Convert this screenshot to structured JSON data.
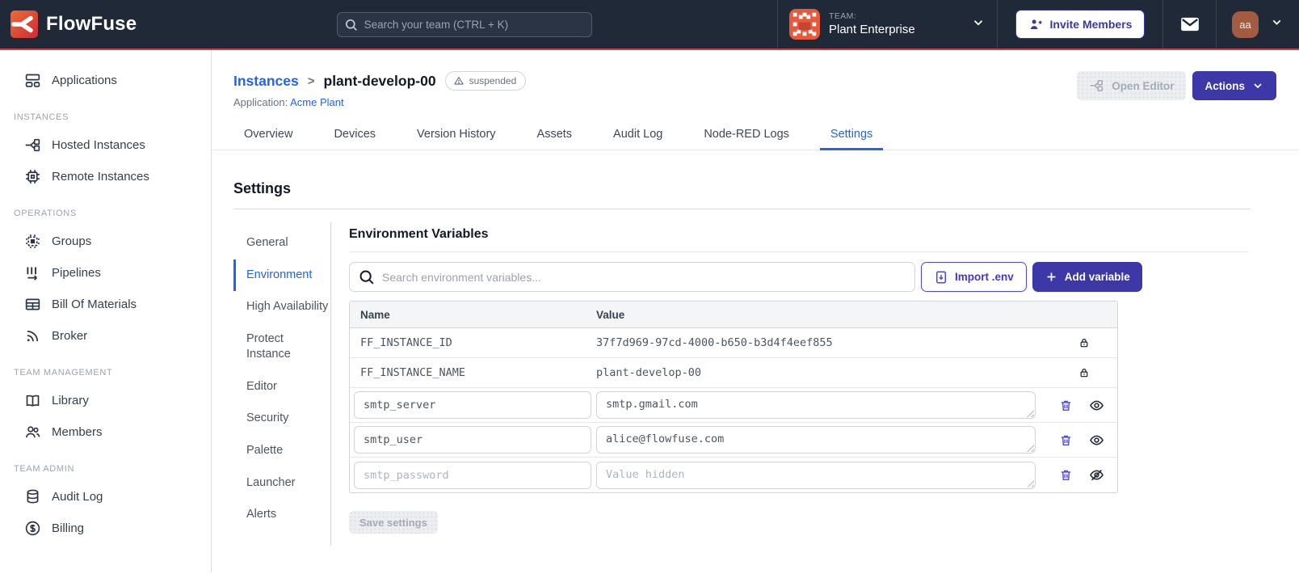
{
  "colors": {
    "navbar_bg": "#1F2937",
    "accent_red": "#D23B3B",
    "link_blue": "#2563EB",
    "primary_indigo": "#3D38A8",
    "icon_indigo": "#4F46E5",
    "team_icon_orange": "#E8593C",
    "avatar_brown": "#A35C42"
  },
  "navbar": {
    "brand": "FlowFuse",
    "search_placeholder": "Search your team (CTRL + K)",
    "team_label": "TEAM:",
    "team_name": "Plant Enterprise",
    "invite_label": "Invite Members",
    "avatar_initials": "aa"
  },
  "sidebar": {
    "sections": [
      {
        "header": "",
        "items": [
          {
            "label": "Applications"
          }
        ]
      },
      {
        "header": "INSTANCES",
        "items": [
          {
            "label": "Hosted Instances"
          },
          {
            "label": "Remote Instances"
          }
        ]
      },
      {
        "header": "OPERATIONS",
        "items": [
          {
            "label": "Groups"
          },
          {
            "label": "Pipelines"
          },
          {
            "label": "Bill Of Materials"
          },
          {
            "label": "Broker"
          }
        ]
      },
      {
        "header": "TEAM MANAGEMENT",
        "items": [
          {
            "label": "Library"
          },
          {
            "label": "Members"
          }
        ]
      },
      {
        "header": "TEAM ADMIN",
        "items": [
          {
            "label": "Audit Log"
          },
          {
            "label": "Billing"
          }
        ]
      }
    ]
  },
  "page_header": {
    "breadcrumb_parent": "Instances",
    "breadcrumb_separator": ">",
    "breadcrumb_current": "plant-develop-00",
    "status_badge": "suspended",
    "application_label": "Application:",
    "application_name": "Acme Plant",
    "open_editor_label": "Open Editor",
    "actions_label": "Actions"
  },
  "tabs": {
    "items": [
      "Overview",
      "Devices",
      "Version History",
      "Assets",
      "Audit Log",
      "Node-RED Logs",
      "Settings"
    ],
    "active": "Settings"
  },
  "settings": {
    "title": "Settings",
    "nav": [
      "General",
      "Environment",
      "High Availability",
      "Protect Instance",
      "Editor",
      "Security",
      "Palette",
      "Launcher",
      "Alerts"
    ],
    "active": "Environment"
  },
  "environment": {
    "title": "Environment Variables",
    "search_placeholder": "Search environment variables...",
    "import_label": "Import .env",
    "add_label": "Add variable",
    "columns": {
      "name": "Name",
      "value": "Value"
    },
    "locked_rows": [
      {
        "name": "FF_INSTANCE_ID",
        "value": "37f7d969-97cd-4000-b650-b3d4f4eef855"
      },
      {
        "name": "FF_INSTANCE_NAME",
        "value": "plant-develop-00"
      }
    ],
    "editable_rows": [
      {
        "name": "smtp_server",
        "value": "smtp.gmail.com",
        "value_placeholder": "",
        "hidden": false
      },
      {
        "name": "smtp_user",
        "value": "alice@flowfuse.com",
        "value_placeholder": "",
        "hidden": false
      },
      {
        "name": "smtp_password",
        "value": "",
        "value_placeholder": "Value hidden",
        "hidden": true
      }
    ],
    "save_label": "Save settings"
  }
}
